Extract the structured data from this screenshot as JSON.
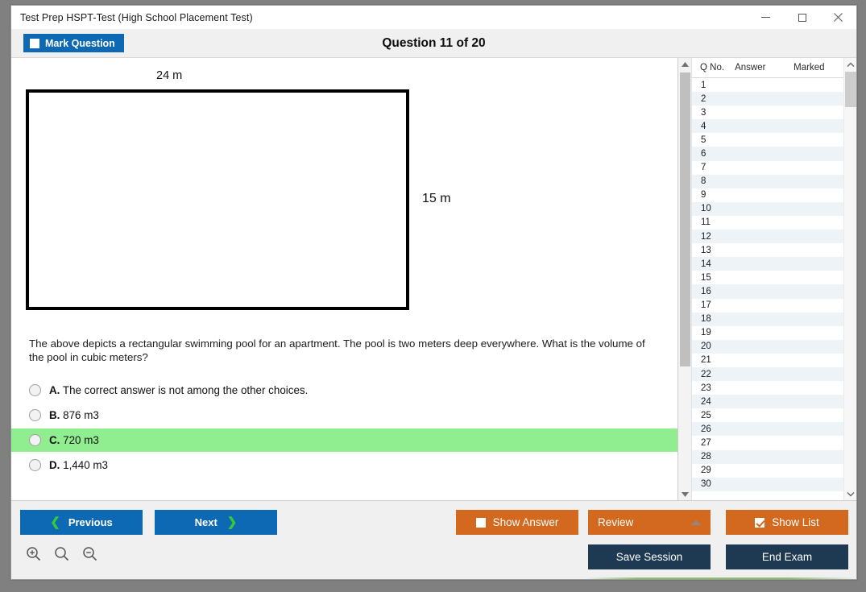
{
  "window": {
    "title": "Test Prep HSPT-Test (High School Placement Test)",
    "minimize_label": "minimize-icon",
    "maximize_label": "maximize-icon",
    "close_label": "close-icon"
  },
  "header": {
    "mark_question_label": "Mark Question",
    "question_title": "Question 11 of 20",
    "mark_question_checked": false
  },
  "diagram": {
    "top_label": "24 m",
    "right_label": "15 m",
    "shape": "rectangle"
  },
  "question": {
    "text": "The above depicts a rectangular swimming pool for an apartment. The pool is two meters deep everywhere. What is the volume of the pool in cubic meters?",
    "options": [
      {
        "letter": "A.",
        "text": "The correct answer is not among the other choices.",
        "selected": false,
        "highlighted": false
      },
      {
        "letter": "B.",
        "text": "876 m3",
        "selected": false,
        "highlighted": false
      },
      {
        "letter": "C.",
        "text": "720 m3",
        "selected": false,
        "highlighted": true
      },
      {
        "letter": "D.",
        "text": "1,440 m3",
        "selected": false,
        "highlighted": false
      }
    ]
  },
  "list": {
    "columns": [
      "Q No.",
      "Answer",
      "Marked"
    ],
    "rows": [
      {
        "no": "1",
        "answer": "",
        "marked": ""
      },
      {
        "no": "2",
        "answer": "",
        "marked": ""
      },
      {
        "no": "3",
        "answer": "",
        "marked": ""
      },
      {
        "no": "4",
        "answer": "",
        "marked": ""
      },
      {
        "no": "5",
        "answer": "",
        "marked": ""
      },
      {
        "no": "6",
        "answer": "",
        "marked": ""
      },
      {
        "no": "7",
        "answer": "",
        "marked": ""
      },
      {
        "no": "8",
        "answer": "",
        "marked": ""
      },
      {
        "no": "9",
        "answer": "",
        "marked": ""
      },
      {
        "no": "10",
        "answer": "",
        "marked": ""
      },
      {
        "no": "11",
        "answer": "",
        "marked": ""
      },
      {
        "no": "12",
        "answer": "",
        "marked": ""
      },
      {
        "no": "13",
        "answer": "",
        "marked": ""
      },
      {
        "no": "14",
        "answer": "",
        "marked": ""
      },
      {
        "no": "15",
        "answer": "",
        "marked": ""
      },
      {
        "no": "16",
        "answer": "",
        "marked": ""
      },
      {
        "no": "17",
        "answer": "",
        "marked": ""
      },
      {
        "no": "18",
        "answer": "",
        "marked": ""
      },
      {
        "no": "19",
        "answer": "",
        "marked": ""
      },
      {
        "no": "20",
        "answer": "",
        "marked": ""
      },
      {
        "no": "21",
        "answer": "",
        "marked": ""
      },
      {
        "no": "22",
        "answer": "",
        "marked": ""
      },
      {
        "no": "23",
        "answer": "",
        "marked": ""
      },
      {
        "no": "24",
        "answer": "",
        "marked": ""
      },
      {
        "no": "25",
        "answer": "",
        "marked": ""
      },
      {
        "no": "26",
        "answer": "",
        "marked": ""
      },
      {
        "no": "27",
        "answer": "",
        "marked": ""
      },
      {
        "no": "28",
        "answer": "",
        "marked": ""
      },
      {
        "no": "29",
        "answer": "",
        "marked": ""
      },
      {
        "no": "30",
        "answer": "",
        "marked": ""
      }
    ]
  },
  "footer": {
    "previous_label": "Previous",
    "next_label": "Next",
    "show_answer_label": "Show Answer",
    "show_answer_checked": false,
    "review_label": "Review",
    "show_list_label": "Show List",
    "show_list_checked": true,
    "save_session_label": "Save Session",
    "end_exam_label": "End Exam",
    "zoom_in_label": "zoom-in-icon",
    "zoom_reset_label": "zoom-reset-icon",
    "zoom_out_label": "zoom-out-icon"
  },
  "colors": {
    "blue": "#0e69b4",
    "orange": "#d2691e",
    "navy": "#1d3a52",
    "highlight_green": "#90ee90",
    "chevron_green": "#33cc33"
  }
}
